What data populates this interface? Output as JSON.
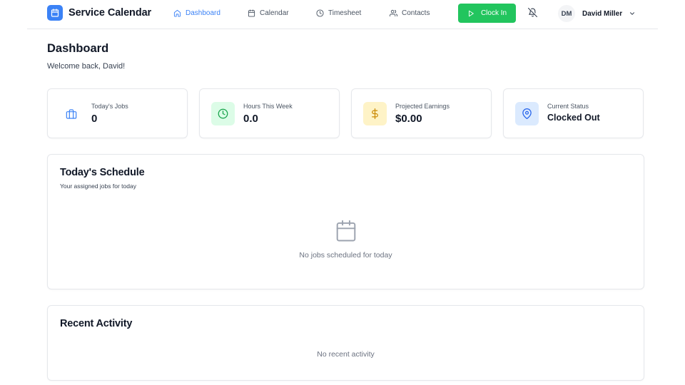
{
  "app": {
    "title": "Service Calendar",
    "logo_icon": "calendar-icon",
    "accent": "#3b82f6"
  },
  "nav": [
    {
      "label": "Dashboard",
      "icon": "home-icon",
      "active": true
    },
    {
      "label": "Calendar",
      "icon": "calendar-icon",
      "active": false
    },
    {
      "label": "Timesheet",
      "icon": "clock-icon",
      "active": false
    },
    {
      "label": "Contacts",
      "icon": "users-icon",
      "active": false
    }
  ],
  "header": {
    "clock_in_label": "Clock In",
    "clock_in_color": "#22c55e",
    "notifications_icon": "bell-off-icon",
    "user": {
      "initials": "DM",
      "name": "David Miller"
    }
  },
  "page": {
    "title": "Dashboard",
    "welcome": "Welcome back, David!"
  },
  "stats": [
    {
      "label": "Today's Jobs",
      "value": "0",
      "icon": "briefcase-icon",
      "icon_color": "#3b82f6",
      "icon_bg": "#ffffff"
    },
    {
      "label": "Hours This Week",
      "value": "0.0",
      "icon": "clock-icon",
      "icon_color": "#16a34a",
      "icon_bg": "#dcfce7"
    },
    {
      "label": "Projected Earnings",
      "value": "$0.00",
      "icon": "dollar-icon",
      "icon_color": "#ca8a04",
      "icon_bg": "#fef3c7"
    },
    {
      "label": "Current Status",
      "value": "Clocked Out",
      "icon": "map-pin-icon",
      "icon_color": "#2563eb",
      "icon_bg": "#dbeafe"
    }
  ],
  "schedule": {
    "title": "Today's Schedule",
    "subtitle": "Your assigned jobs for today",
    "empty_icon": "calendar-icon",
    "empty_text": "No jobs scheduled for today"
  },
  "activity": {
    "title": "Recent Activity",
    "empty_text": "No recent activity"
  }
}
